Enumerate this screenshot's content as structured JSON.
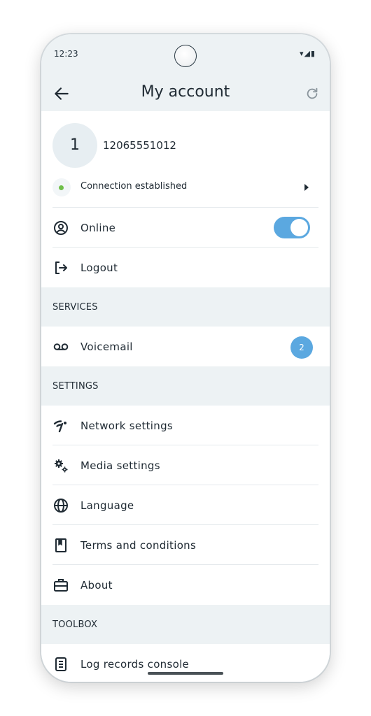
{
  "status_bar": {
    "time": "12:23",
    "icons": "▾◢▮"
  },
  "header": {
    "title": "My account"
  },
  "account": {
    "avatar_text": "1",
    "number": "12065551012",
    "connection_label": "Connection established"
  },
  "menu": {
    "online_label": "Online",
    "online_enabled": true,
    "logout_label": "Logout"
  },
  "services": {
    "header": "SERVICES",
    "voicemail_label": "Voicemail",
    "voicemail_count": "2"
  },
  "settings": {
    "header": "SETTINGS",
    "network_label": "Network settings",
    "media_label": "Media settings",
    "language_label": "Language",
    "terms_label": "Terms and conditions",
    "about_label": "About"
  },
  "toolbox": {
    "header": "TOOLBOX",
    "log_label": "Log records console"
  },
  "colors": {
    "accent": "#5ba8e0",
    "status_ok": "#6fbf4a",
    "section_bg": "#edf2f4"
  }
}
